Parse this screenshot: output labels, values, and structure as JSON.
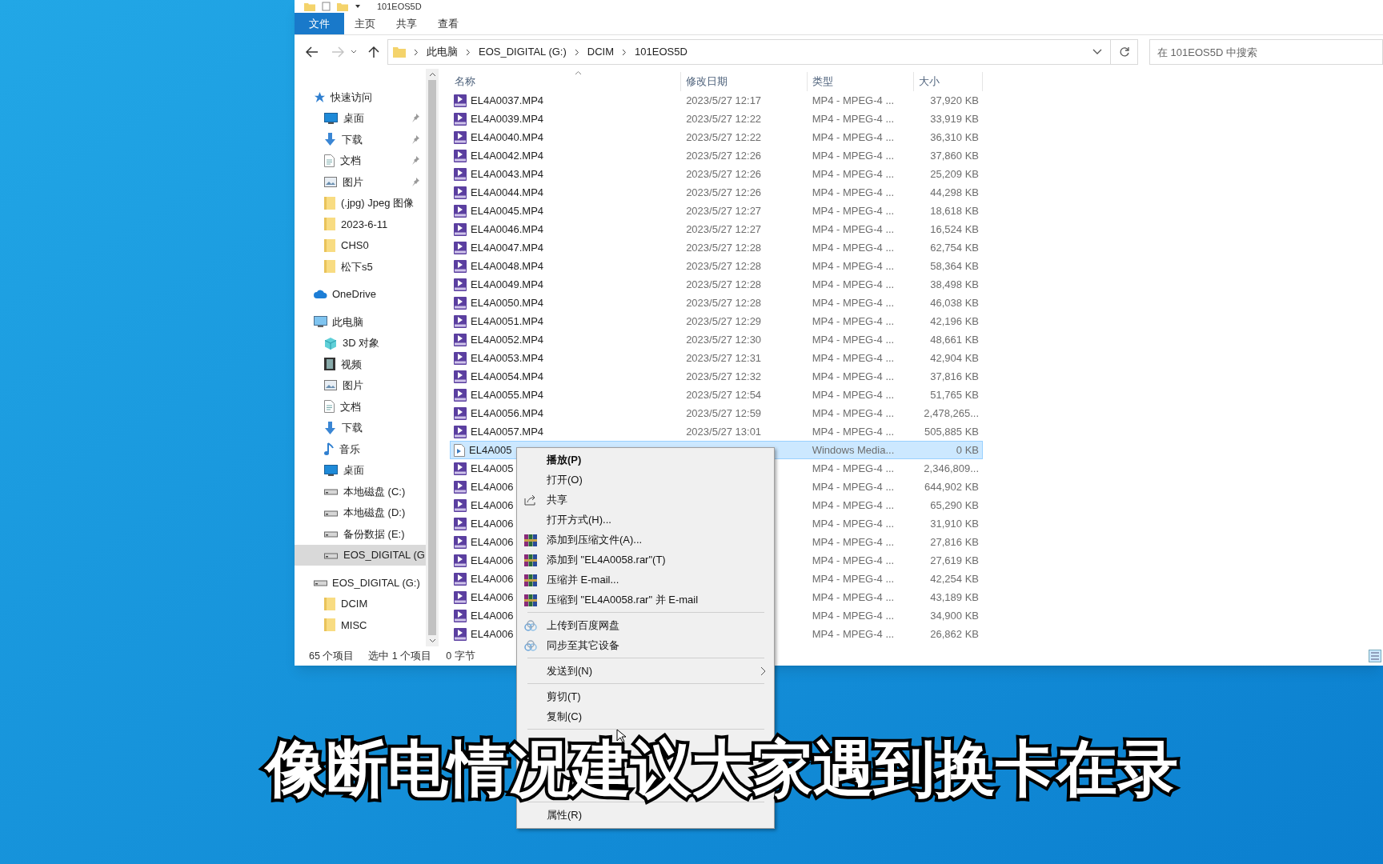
{
  "window": {
    "title": "101EOS5D"
  },
  "ribbon_tabs": [
    {
      "label": "文件",
      "selected": true
    },
    {
      "label": "主页",
      "selected": false
    },
    {
      "label": "共享",
      "selected": false
    },
    {
      "label": "查看",
      "selected": false
    }
  ],
  "address": {
    "crumbs": [
      "此电脑",
      "EOS_DIGITAL (G:)",
      "DCIM",
      "101EOS5D"
    ]
  },
  "search": {
    "placeholder": "在 101EOS5D 中搜索"
  },
  "sidebar": {
    "groups": [
      {
        "label": "快速访问",
        "kind": "star",
        "selected": false,
        "children": [
          {
            "label": "桌面",
            "kind": "desktop",
            "pinned": true,
            "selected": false
          },
          {
            "label": "下载",
            "kind": "download",
            "pinned": true,
            "selected": false
          },
          {
            "label": "文档",
            "kind": "document",
            "pinned": true,
            "selected": false
          },
          {
            "label": "图片",
            "kind": "picture",
            "pinned": true,
            "selected": false
          },
          {
            "label": "(.jpg) Jpeg 图像",
            "kind": "folder",
            "pinned": false,
            "selected": false
          },
          {
            "label": "2023-6-11",
            "kind": "folder",
            "pinned": false,
            "selected": false
          },
          {
            "label": "CHS0",
            "kind": "folder",
            "pinned": false,
            "selected": false
          },
          {
            "label": "松下s5",
            "kind": "folder",
            "pinned": false,
            "selected": false
          }
        ]
      },
      {
        "label": "OneDrive",
        "kind": "cloud",
        "selected": false
      },
      {
        "label": "此电脑",
        "kind": "pc",
        "selected": false,
        "children": [
          {
            "label": "3D 对象",
            "kind": "cube",
            "pinned": false,
            "selected": false
          },
          {
            "label": "视频",
            "kind": "video",
            "pinned": false,
            "selected": false
          },
          {
            "label": "图片",
            "kind": "picture",
            "pinned": false,
            "selected": false
          },
          {
            "label": "文档",
            "kind": "document",
            "pinned": false,
            "selected": false
          },
          {
            "label": "下载",
            "kind": "download",
            "pinned": false,
            "selected": false
          },
          {
            "label": "音乐",
            "kind": "music",
            "pinned": false,
            "selected": false
          },
          {
            "label": "桌面",
            "kind": "desktop",
            "pinned": false,
            "selected": false
          },
          {
            "label": "本地磁盘 (C:)",
            "kind": "drive",
            "pinned": false,
            "selected": false
          },
          {
            "label": "本地磁盘 (D:)",
            "kind": "drive",
            "pinned": false,
            "selected": false
          },
          {
            "label": "备份数据 (E:)",
            "kind": "drive",
            "pinned": false,
            "selected": false
          },
          {
            "label": "EOS_DIGITAL (G",
            "kind": "drive",
            "pinned": false,
            "selected": true
          }
        ]
      },
      {
        "label": "EOS_DIGITAL (G:)",
        "kind": "drive",
        "selected": false,
        "children": [
          {
            "label": "DCIM",
            "kind": "folder",
            "pinned": false,
            "selected": false
          },
          {
            "label": "MISC",
            "kind": "folder",
            "pinned": false,
            "selected": false
          }
        ]
      }
    ]
  },
  "table": {
    "columns": [
      "名称",
      "修改日期",
      "类型",
      "大小"
    ],
    "rows": [
      {
        "name": "EL4A0037.MP4",
        "date": "2023/5/27 12:17",
        "type": "MP4 - MPEG-4 ...",
        "size": "37,920 KB",
        "kind": "mp4",
        "selected": false
      },
      {
        "name": "EL4A0039.MP4",
        "date": "2023/5/27 12:22",
        "type": "MP4 - MPEG-4 ...",
        "size": "33,919 KB",
        "kind": "mp4",
        "selected": false
      },
      {
        "name": "EL4A0040.MP4",
        "date": "2023/5/27 12:22",
        "type": "MP4 - MPEG-4 ...",
        "size": "36,310 KB",
        "kind": "mp4",
        "selected": false
      },
      {
        "name": "EL4A0042.MP4",
        "date": "2023/5/27 12:26",
        "type": "MP4 - MPEG-4 ...",
        "size": "37,860 KB",
        "kind": "mp4",
        "selected": false
      },
      {
        "name": "EL4A0043.MP4",
        "date": "2023/5/27 12:26",
        "type": "MP4 - MPEG-4 ...",
        "size": "25,209 KB",
        "kind": "mp4",
        "selected": false
      },
      {
        "name": "EL4A0044.MP4",
        "date": "2023/5/27 12:26",
        "type": "MP4 - MPEG-4 ...",
        "size": "44,298 KB",
        "kind": "mp4",
        "selected": false
      },
      {
        "name": "EL4A0045.MP4",
        "date": "2023/5/27 12:27",
        "type": "MP4 - MPEG-4 ...",
        "size": "18,618 KB",
        "kind": "mp4",
        "selected": false
      },
      {
        "name": "EL4A0046.MP4",
        "date": "2023/5/27 12:27",
        "type": "MP4 - MPEG-4 ...",
        "size": "16,524 KB",
        "kind": "mp4",
        "selected": false
      },
      {
        "name": "EL4A0047.MP4",
        "date": "2023/5/27 12:28",
        "type": "MP4 - MPEG-4 ...",
        "size": "62,754 KB",
        "kind": "mp4",
        "selected": false
      },
      {
        "name": "EL4A0048.MP4",
        "date": "2023/5/27 12:28",
        "type": "MP4 - MPEG-4 ...",
        "size": "58,364 KB",
        "kind": "mp4",
        "selected": false
      },
      {
        "name": "EL4A0049.MP4",
        "date": "2023/5/27 12:28",
        "type": "MP4 - MPEG-4 ...",
        "size": "38,498 KB",
        "kind": "mp4",
        "selected": false
      },
      {
        "name": "EL4A0050.MP4",
        "date": "2023/5/27 12:28",
        "type": "MP4 - MPEG-4 ...",
        "size": "46,038 KB",
        "kind": "mp4",
        "selected": false
      },
      {
        "name": "EL4A0051.MP4",
        "date": "2023/5/27 12:29",
        "type": "MP4 - MPEG-4 ...",
        "size": "42,196 KB",
        "kind": "mp4",
        "selected": false
      },
      {
        "name": "EL4A0052.MP4",
        "date": "2023/5/27 12:30",
        "type": "MP4 - MPEG-4 ...",
        "size": "48,661 KB",
        "kind": "mp4",
        "selected": false
      },
      {
        "name": "EL4A0053.MP4",
        "date": "2023/5/27 12:31",
        "type": "MP4 - MPEG-4 ...",
        "size": "42,904 KB",
        "kind": "mp4",
        "selected": false
      },
      {
        "name": "EL4A0054.MP4",
        "date": "2023/5/27 12:32",
        "type": "MP4 - MPEG-4 ...",
        "size": "37,816 KB",
        "kind": "mp4",
        "selected": false
      },
      {
        "name": "EL4A0055.MP4",
        "date": "2023/5/27 12:54",
        "type": "MP4 - MPEG-4 ...",
        "size": "51,765 KB",
        "kind": "mp4",
        "selected": false
      },
      {
        "name": "EL4A0056.MP4",
        "date": "2023/5/27 12:59",
        "type": "MP4 - MPEG-4 ...",
        "size": "2,478,265...",
        "kind": "mp4",
        "selected": false
      },
      {
        "name": "EL4A0057.MP4",
        "date": "2023/5/27 13:01",
        "type": "MP4 - MPEG-4 ...",
        "size": "505,885 KB",
        "kind": "mp4",
        "selected": false
      },
      {
        "name": "EL4A005",
        "type": "Windows Media...",
        "size": "0 KB",
        "kind": "media",
        "selected": true
      },
      {
        "name": "EL4A005",
        "type": "MP4 - MPEG-4 ...",
        "size": "2,346,809...",
        "kind": "mp4",
        "selected": false
      },
      {
        "name": "EL4A006",
        "type": "MP4 - MPEG-4 ...",
        "size": "644,902 KB",
        "kind": "mp4",
        "selected": false
      },
      {
        "name": "EL4A006",
        "type": "MP4 - MPEG-4 ...",
        "size": "65,290 KB",
        "kind": "mp4",
        "selected": false
      },
      {
        "name": "EL4A006",
        "type": "MP4 - MPEG-4 ...",
        "size": "31,910 KB",
        "kind": "mp4",
        "selected": false
      },
      {
        "name": "EL4A006",
        "type": "MP4 - MPEG-4 ...",
        "size": "27,816 KB",
        "kind": "mp4",
        "selected": false
      },
      {
        "name": "EL4A006",
        "type": "MP4 - MPEG-4 ...",
        "size": "27,619 KB",
        "kind": "mp4",
        "selected": false
      },
      {
        "name": "EL4A006",
        "type": "MP4 - MPEG-4 ...",
        "size": "42,254 KB",
        "kind": "mp4",
        "selected": false
      },
      {
        "name": "EL4A006",
        "type": "MP4 - MPEG-4 ...",
        "size": "43,189 KB",
        "kind": "mp4",
        "selected": false
      },
      {
        "name": "EL4A006",
        "type": "MP4 - MPEG-4 ...",
        "size": "34,900 KB",
        "kind": "mp4",
        "selected": false
      },
      {
        "name": "EL4A006",
        "type": "MP4 - MPEG-4 ...",
        "size": "26,862 KB",
        "kind": "mp4",
        "selected": false
      }
    ]
  },
  "status_bar": [
    "65 个项目",
    "选中 1 个项目",
    "0 字节"
  ],
  "context_menu": {
    "items": [
      {
        "kind": "item",
        "label": "播放(P)",
        "default": true
      },
      {
        "kind": "item",
        "label": "打开(O)",
        "default": false
      },
      {
        "kind": "share",
        "label": "共享",
        "default": false
      },
      {
        "kind": "item",
        "label": "打开方式(H)...",
        "default": false
      },
      {
        "kind": "archive",
        "label": "添加到压缩文件(A)...",
        "default": false
      },
      {
        "kind": "archive",
        "label": "添加到 \"EL4A0058.rar\"(T)",
        "default": false
      },
      {
        "kind": "archive",
        "label": "压缩并 E-mail...",
        "default": false
      },
      {
        "kind": "archive",
        "label": "压缩到 \"EL4A0058.rar\" 并 E-mail",
        "default": false
      },
      {
        "kind": "separator"
      },
      {
        "kind": "cloud",
        "label": "上传到百度网盘",
        "default": false
      },
      {
        "kind": "cloud",
        "label": "同步至其它设备",
        "default": false
      },
      {
        "kind": "separator"
      },
      {
        "kind": "submenu",
        "label": "发送到(N)",
        "default": false
      },
      {
        "kind": "separator"
      },
      {
        "kind": "item",
        "label": "剪切(T)",
        "default": false
      },
      {
        "kind": "item",
        "label": "复制(C)",
        "default": false
      },
      {
        "kind": "separator"
      }
    ],
    "bottom_items": [
      {
        "kind": "separator"
      },
      {
        "kind": "item",
        "label": "属性(R)",
        "default": false
      }
    ]
  },
  "subtitle": "像断电情况建议大家遇到换卡在录"
}
